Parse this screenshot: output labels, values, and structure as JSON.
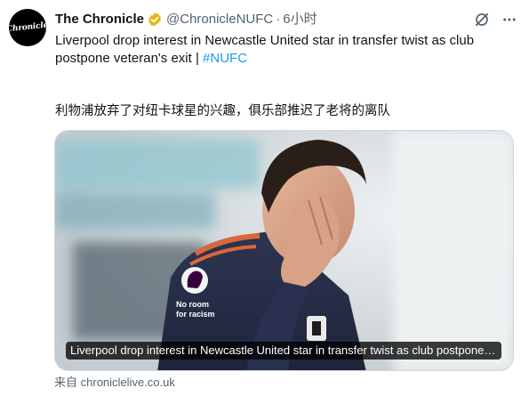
{
  "tweet": {
    "avatar_text": "Chronicle",
    "display_name": "The Chronicle",
    "handle": "@ChronicleNUFC",
    "separator": "·",
    "time": "6小时",
    "text": "Liverpool drop interest in Newcastle United star in transfer twist as club postpone veteran's exit | ",
    "hashtag": "#NUFC",
    "translation": "利物浦放弃了对纽卡球星的兴趣，俱乐部推迟了老将的离队"
  },
  "card": {
    "caption": "Liverpool drop interest in Newcastle United star in transfer twist as club postpone veteran's exit",
    "source_prefix": "来自",
    "source_domain": "chroniclelive.co.uk",
    "shirt_text_line1": "No room",
    "shirt_text_line2": "for racism"
  },
  "colors": {
    "accent": "#1d9bf0",
    "verified_gold": "#e2b719",
    "secondary_text": "#536471",
    "primary_text": "#0f1419"
  },
  "icons": {
    "verified": "verified-badge-icon",
    "grok": "grok-icon",
    "more": "more-icon",
    "premier_league": "premier-league-lion-icon"
  }
}
